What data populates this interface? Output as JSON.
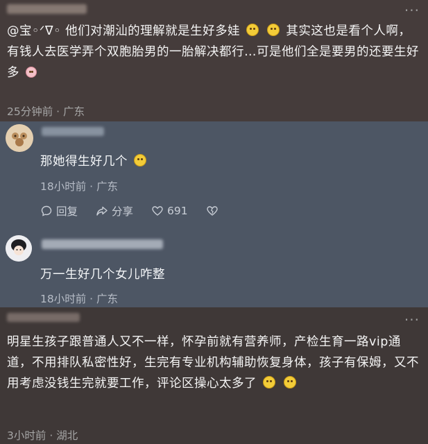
{
  "comment1": {
    "text": "@宝◦ᐟᐁ◦ 他们对潮汕的理解就是生好多娃",
    "text2": "其实这也是看个人啊，有钱人去医学弄个双胞胎男的一胎解决都行…可是他们全是要男的还要生好多",
    "time": "25分钟前",
    "sep": "·",
    "location": "广东"
  },
  "reply1": {
    "text": "那她得生好几个",
    "time": "18小时前",
    "sep": "·",
    "location": "广东",
    "actions": {
      "reply": "回复",
      "share": "分享",
      "likes": "691"
    }
  },
  "reply2": {
    "text": "万一生好几个女儿咋整",
    "time": "18小时前",
    "sep": "·",
    "location": "广东"
  },
  "comment2": {
    "text": "明星生孩子跟普通人又不一样，怀孕前就有营养师，产检生育一路vip通道，不用排队私密性好，生完有专业机构辅助恢复身体，孩子有保姆，又不用考虑没钱生完就要工作，评论区操心太多了",
    "time": "3小时前",
    "sep": "·",
    "location": "湖北"
  },
  "more_icon": "ellipsis-icon",
  "colors": {
    "panel_top": "#453c3b",
    "panel_mid": "#4d5664",
    "panel_bottom": "#3f3837",
    "emoji": "#f3cc38"
  }
}
